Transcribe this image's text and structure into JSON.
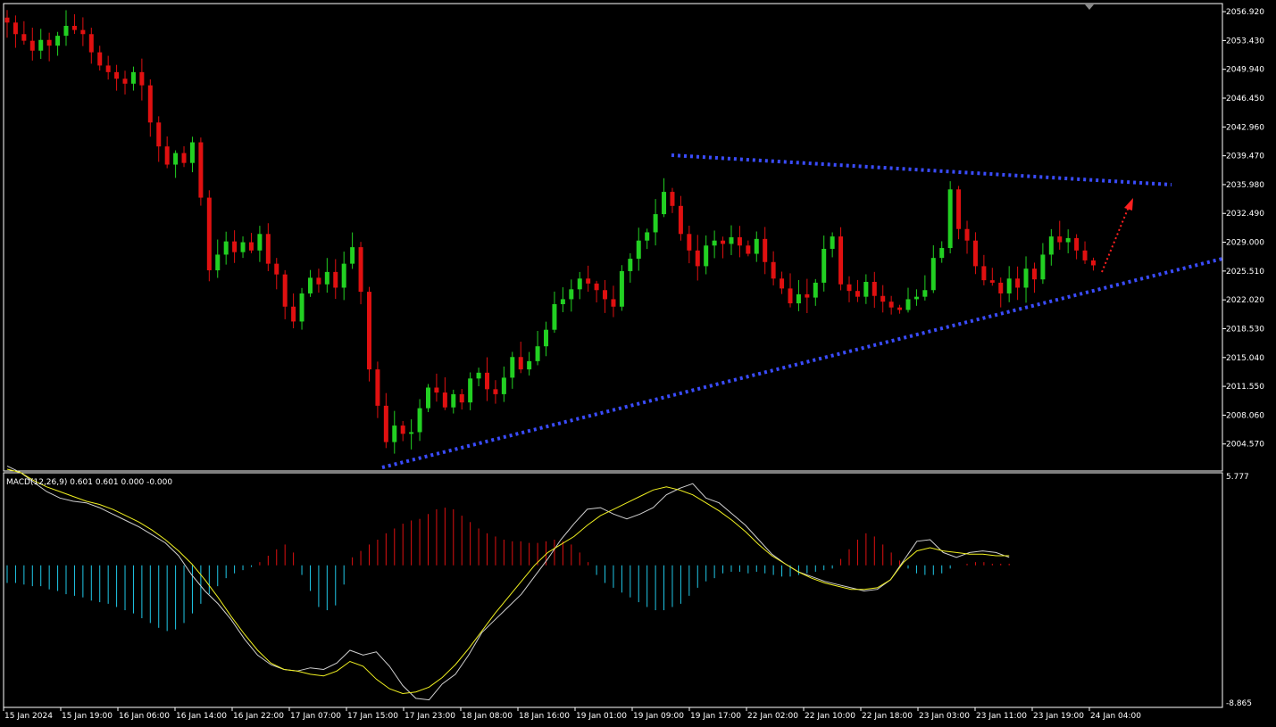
{
  "colors": {
    "background": "#000000",
    "frame": "#ffffff",
    "bull_candle": "#22d022",
    "bear_candle": "#e01010",
    "trendline": "#3a4cff",
    "projection_arrow": "#ff2020",
    "macd_line": "#d0d0d0",
    "signal_line": "#f0f020",
    "hist_positive": "#e01010",
    "hist_negative": "#20c8e8"
  },
  "indicator": {
    "label": "MACD(12,26,9) 0.601 0.601 0.000 -0.000",
    "axis_max": "5.777",
    "axis_min": "-8.865"
  },
  "chart_data": {
    "type": "candlestick",
    "instrument_timeframe_hint": "H1",
    "price_axis_ticks": [
      "2056.920",
      "2053.430",
      "2049.940",
      "2046.450",
      "2042.960",
      "2039.470",
      "2035.980",
      "2032.490",
      "2029.000",
      "2025.510",
      "2022.020",
      "2018.530",
      "2015.040",
      "2011.550",
      "2008.060",
      "2004.570"
    ],
    "ylim": [
      2001.3,
      2057.9
    ],
    "time_axis_labels": [
      "15 Jan 2024",
      "15 Jan 19:00",
      "16 Jan 06:00",
      "16 Jan 14:00",
      "16 Jan 22:00",
      "17 Jan 07:00",
      "17 Jan 15:00",
      "17 Jan 23:00",
      "18 Jan 08:00",
      "18 Jan 16:00",
      "19 Jan 01:00",
      "19 Jan 09:00",
      "19 Jan 17:00",
      "22 Jan 02:00",
      "22 Jan 10:00",
      "22 Jan 18:00",
      "23 Jan 03:00",
      "23 Jan 11:00",
      "23 Jan 19:00",
      "24 Jan 04:00"
    ],
    "close_path": [
      2055.6,
      2054.2,
      2053.4,
      2052.2,
      2053.5,
      2052.8,
      2054.0,
      2055.2,
      2054.7,
      2054.2,
      2052.0,
      2050.4,
      2049.6,
      2048.8,
      2048.2,
      2049.6,
      2048.0,
      2043.5,
      2040.6,
      2038.4,
      2039.8,
      2038.6,
      2041.1,
      2034.4,
      2025.6,
      2027.5,
      2029.1,
      2027.8,
      2029.0,
      2028.0,
      2030.0,
      2026.4,
      2025.1,
      2021.2,
      2019.4,
      2022.8,
      2024.7,
      2023.9,
      2025.4,
      2023.5,
      2026.4,
      2028.4,
      2023.0,
      2013.6,
      2009.2,
      2004.8,
      2006.8,
      2005.8,
      2006.0,
      2008.9,
      2011.4,
      2010.8,
      2009.0,
      2010.6,
      2009.6,
      2012.5,
      2013.2,
      2011.2,
      2010.6,
      2012.6,
      2015.1,
      2013.6,
      2014.6,
      2016.4,
      2018.4,
      2021.5,
      2022.1,
      2023.3,
      2024.6,
      2024.0,
      2023.2,
      2022.1,
      2021.2,
      2025.5,
      2027.0,
      2029.2,
      2030.2,
      2032.4,
      2035.1,
      2033.4,
      2030.0,
      2028.0,
      2026.1,
      2028.6,
      2029.2,
      2028.8,
      2029.6,
      2028.6,
      2027.6,
      2029.4,
      2026.6,
      2024.6,
      2023.4,
      2021.6,
      2022.7,
      2022.3,
      2024.1,
      2028.2,
      2029.7,
      2023.9,
      2023.1,
      2022.4,
      2024.2,
      2022.5,
      2021.8,
      2021.1,
      2020.8,
      2022.1,
      2022.4,
      2023.2,
      2027.1,
      2028.3,
      2035.4,
      2030.6,
      2029.2,
      2026.1,
      2024.4,
      2024.1,
      2022.8,
      2024.6,
      2023.5,
      2025.8,
      2024.5,
      2027.5,
      2029.7,
      2029.0,
      2029.5,
      2028.0,
      2026.8,
      2026.2
    ],
    "macd_line": [
      6.2,
      5.8,
      5.2,
      4.6,
      4.2,
      4.0,
      3.9,
      3.6,
      3.2,
      2.8,
      2.4,
      1.9,
      1.4,
      0.6,
      -0.6,
      -1.6,
      -2.4,
      -3.4,
      -4.6,
      -5.6,
      -6.2,
      -6.5,
      -6.6,
      -6.4,
      -6.5,
      -6.1,
      -5.3,
      -5.6,
      -5.4,
      -6.3,
      -7.5,
      -8.3,
      -8.4,
      -7.4,
      -6.8,
      -5.6,
      -4.2,
      -3.4,
      -2.6,
      -1.8,
      -0.7,
      0.4,
      1.6,
      2.6,
      3.5,
      3.6,
      3.2,
      2.9,
      3.2,
      3.6,
      4.4,
      4.8,
      5.1,
      4.2,
      3.9,
      3.2,
      2.5,
      1.6,
      0.7,
      0.1,
      -0.4,
      -0.7,
      -1.0,
      -1.2,
      -1.4,
      -1.6,
      -1.5,
      -0.9,
      0.3,
      1.5,
      1.6,
      0.8,
      0.5,
      0.8,
      0.9,
      0.8,
      0.5
    ],
    "signal_line": [
      6.0,
      5.8,
      5.3,
      4.9,
      4.6,
      4.3,
      4.0,
      3.8,
      3.5,
      3.1,
      2.7,
      2.2,
      1.6,
      0.9,
      0.1,
      -0.9,
      -2.0,
      -3.2,
      -4.3,
      -5.3,
      -6.1,
      -6.5,
      -6.6,
      -6.8,
      -6.9,
      -6.6,
      -6.0,
      -6.3,
      -7.1,
      -7.7,
      -8.0,
      -7.9,
      -7.6,
      -7.0,
      -6.2,
      -5.2,
      -4.1,
      -3.0,
      -2.0,
      -1.0,
      0.0,
      0.8,
      1.3,
      1.8,
      2.5,
      3.1,
      3.5,
      3.9,
      4.3,
      4.7,
      4.9,
      4.7,
      4.4,
      3.9,
      3.4,
      2.8,
      2.1,
      1.3,
      0.6,
      0.1,
      -0.4,
      -0.8,
      -1.1,
      -1.3,
      -1.5,
      -1.5,
      -1.4,
      -0.9,
      0.2,
      0.9,
      1.1,
      0.9,
      0.8,
      0.7,
      0.7,
      0.6,
      0.6
    ],
    "macd_histogram": [
      -1.1,
      -1.1,
      -1.2,
      -1.3,
      -1.3,
      -1.5,
      -1.6,
      -1.8,
      -1.9,
      -2.0,
      -2.2,
      -2.3,
      -2.4,
      -2.6,
      -2.8,
      -3.0,
      -3.3,
      -3.6,
      -3.9,
      -4.1,
      -4.0,
      -3.6,
      -3.0,
      -2.4,
      -1.8,
      -1.3,
      -0.8,
      -0.5,
      -0.3,
      -0.1,
      0.2,
      0.6,
      1.0,
      1.3,
      0.8,
      -0.6,
      -1.6,
      -2.6,
      -2.8,
      -2.5,
      -1.2,
      0.5,
      0.9,
      1.3,
      1.6,
      2.0,
      2.3,
      2.6,
      2.8,
      2.9,
      3.2,
      3.5,
      3.6,
      3.5,
      3.1,
      2.7,
      2.3,
      2.0,
      1.8,
      1.6,
      1.5,
      1.5,
      1.4,
      1.4,
      1.5,
      1.6,
      1.5,
      1.3,
      0.8,
      0.2,
      -0.6,
      -1.1,
      -1.4,
      -1.7,
      -2.0,
      -2.3,
      -2.6,
      -2.8,
      -2.8,
      -2.6,
      -2.4,
      -1.9,
      -1.4,
      -1.0,
      -0.8,
      -0.5,
      -0.4,
      -0.4,
      -0.5,
      -0.4,
      -0.5,
      -0.6,
      -0.7,
      -0.7,
      -0.6,
      -0.5,
      -0.4,
      -0.3,
      -0.2,
      0.4,
      1.0,
      1.6,
      2.0,
      1.8,
      1.3,
      0.8,
      0.3,
      -0.2,
      -0.5,
      -0.6,
      -0.6,
      -0.5,
      -0.2,
      0.0,
      0.1,
      0.2,
      0.2,
      0.1,
      0.1,
      0.1
    ],
    "upper_trendline": {
      "from": {
        "time": "19 Jan ~10:00",
        "price": 2039.4
      },
      "to": {
        "time": "24 Jan ~06:00",
        "price": 2035.8
      },
      "style": "dotted"
    },
    "lower_trendline": {
      "from": {
        "time": "17 Jan ~15:00",
        "price": 2001.5
      },
      "to": {
        "time": "24 Jan ~08:00",
        "price": 2026.8
      },
      "style": "dotted"
    },
    "projection_arrow": {
      "from": {
        "time": "24 Jan ~00:00",
        "price": 2025.8
      },
      "to": {
        "time": "24 Jan ~03:00",
        "price": 2033.4
      },
      "direction": "up"
    },
    "grid": false
  }
}
